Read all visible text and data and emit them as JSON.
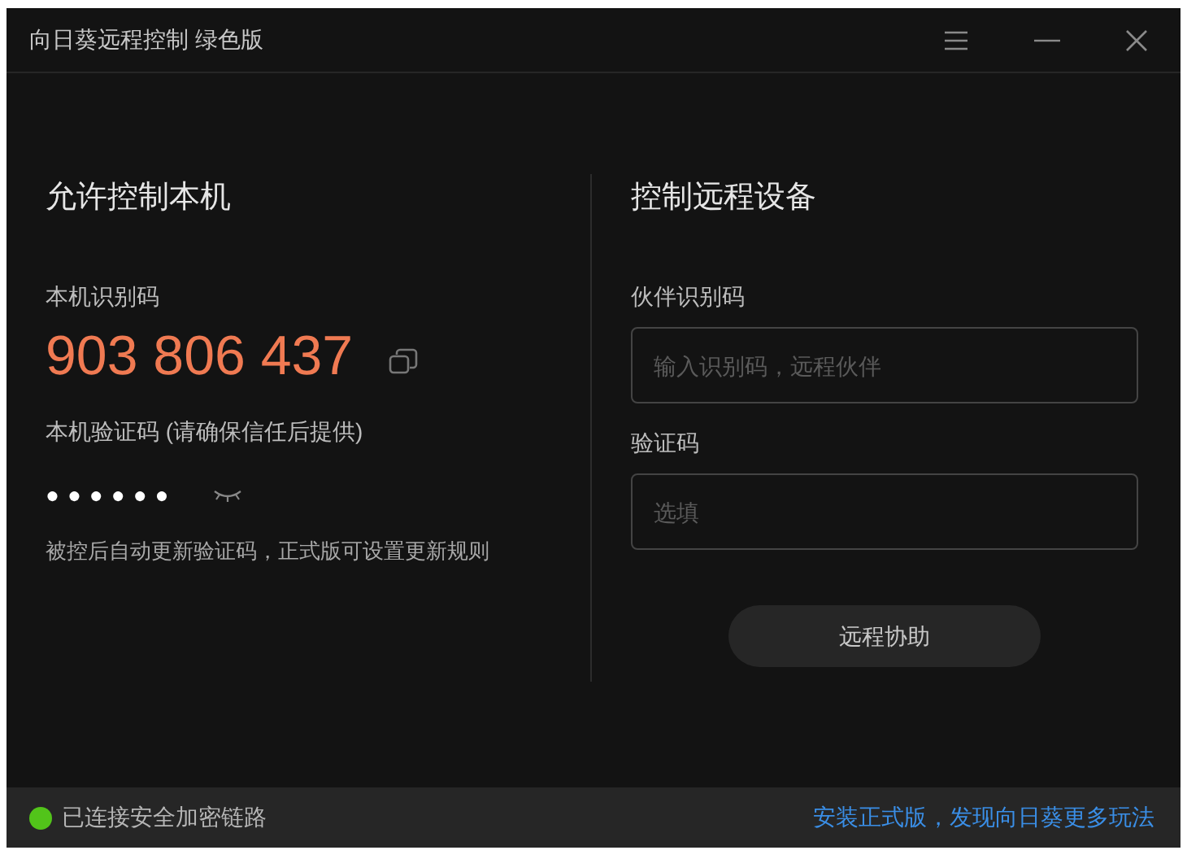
{
  "window": {
    "title": "向日葵远程控制 绿色版"
  },
  "left": {
    "heading": "允许控制本机",
    "id_label": "本机识别码",
    "id_value": "903 806 437",
    "code_label": "本机验证码 (请确保信任后提供)",
    "code_mask": "●●●●●●",
    "note": "被控后自动更新验证码，正式版可设置更新规则"
  },
  "right": {
    "heading": "控制远程设备",
    "partner_label": "伙伴识别码",
    "partner_field": {
      "placeholder": "输入识别码，远程伙伴"
    },
    "code_label": "验证码",
    "code_field": {
      "placeholder": "选填"
    },
    "button": "远程协助"
  },
  "status_bar": {
    "status": "已连接安全加密链路",
    "color": "#52c41a",
    "link": "安装正式版，发现向日葵更多玩法"
  }
}
